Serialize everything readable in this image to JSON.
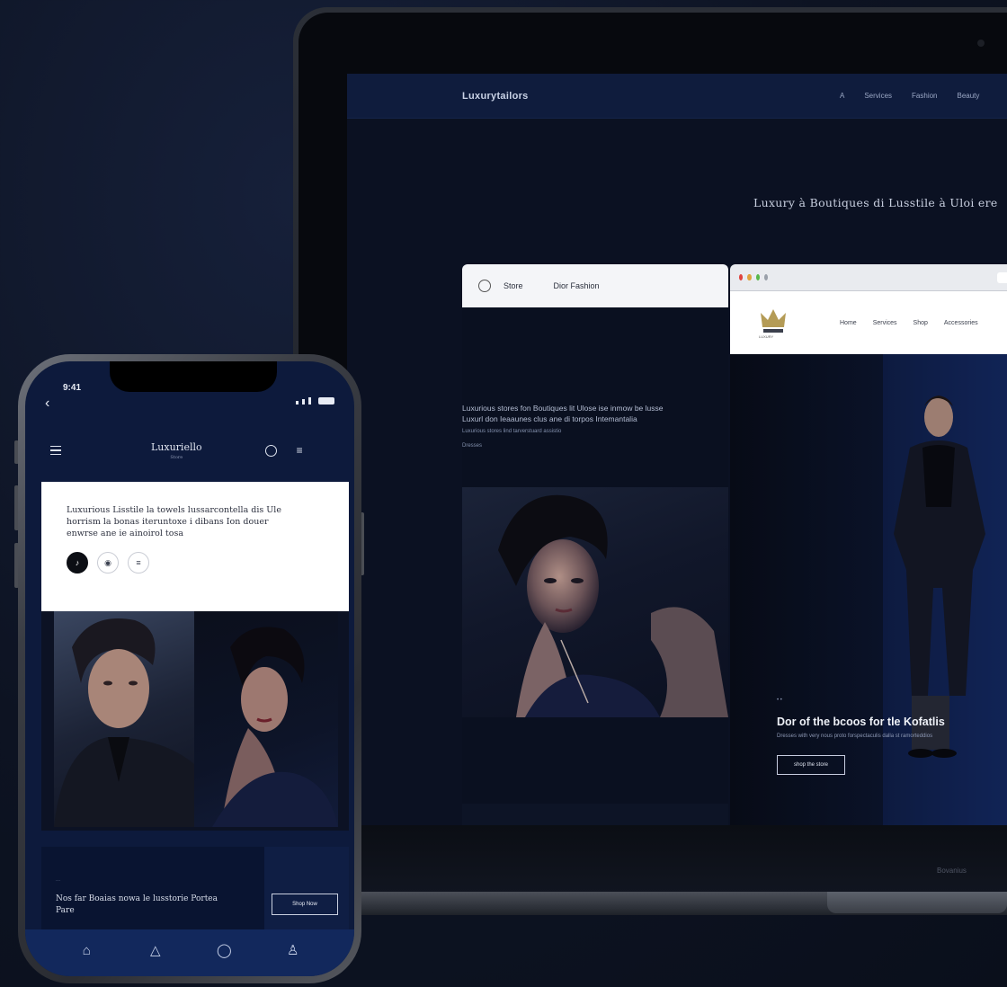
{
  "laptop": {
    "site": {
      "logo": "Luxurytailors",
      "nav": [
        "A",
        "Services",
        "Fashion",
        "Beauty"
      ],
      "hero_text": "Luxury à Boutiques di Lusstile à Uloi ere"
    },
    "window1": {
      "tabs": [
        "Store",
        "Dior Fashion"
      ],
      "body_lines": [
        "Luxurious stores fon Boutiques lit Ulose ise inmow be lusse",
        "Luxurl don Ieaaunes clus ane di torpos Intemantalia",
        "Luxurious stores lind tarverstuard assistio"
      ],
      "small_text": "Dresses"
    },
    "window2": {
      "nav": [
        "Home",
        "Services",
        "Shop",
        "Accessories"
      ],
      "hero_title": "Dor of the bcoos for tle Kofatlis",
      "hero_subtitle": "Dresses with very nous proto forspectaculis dalla st ramorteddios",
      "hero_button": "shop the store",
      "crown_caption": "LUXURY"
    },
    "footer_text": "Bovanius"
  },
  "phone": {
    "status": {
      "time": "9:41"
    },
    "header": {
      "logo": "Luxuriello",
      "logo_sub": "Store"
    },
    "card": {
      "text": "Luxurious Lisstile la towels lussarcontella dis Ule horrism la bonas iteruntoxe i dibans Ion douer enwrse ane ie ainoirol tosa"
    },
    "promo": {
      "small": "...",
      "text": "Nos far Boaias nowa le lusstorie Portea Pare",
      "button": "Shop Now"
    },
    "tabs": [
      "home-icon",
      "store-icon",
      "bell-icon",
      "profile-icon"
    ]
  },
  "colors": {
    "background": "#0d1322",
    "navy": "#0f1c3d",
    "accent_blue": "#142a62"
  }
}
